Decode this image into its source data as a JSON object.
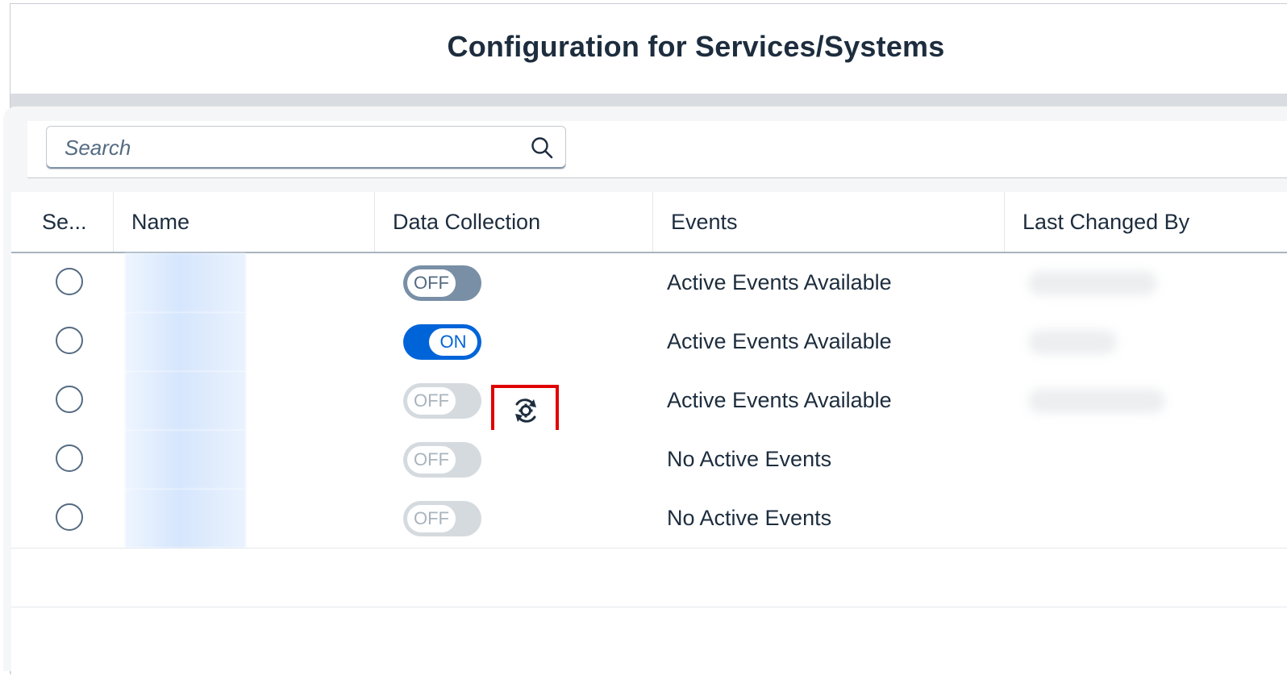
{
  "header": {
    "title": "Configuration for Services/Systems"
  },
  "search": {
    "placeholder": "Search",
    "value": ""
  },
  "table": {
    "columns": [
      {
        "key": "select",
        "label": "Se..."
      },
      {
        "key": "name",
        "label": "Name"
      },
      {
        "key": "data_collection",
        "label": "Data Collection"
      },
      {
        "key": "events",
        "label": "Events"
      },
      {
        "key": "last_changed_by",
        "label": "Last Changed By"
      }
    ],
    "rows": [
      {
        "toggle_state": "off",
        "toggle_label": "OFF",
        "events": "Active Events Available",
        "name": "",
        "last_changed_by": ""
      },
      {
        "toggle_state": "on",
        "toggle_label": "ON",
        "events": "Active Events Available",
        "name": "",
        "last_changed_by": ""
      },
      {
        "toggle_state": "off-disabled",
        "toggle_label": "OFF",
        "events": "Active Events Available",
        "name": "",
        "last_changed_by": "",
        "action_icon": "sync-settings-icon"
      },
      {
        "toggle_state": "off-disabled",
        "toggle_label": "OFF",
        "events": "No Active Events",
        "name": "",
        "last_changed_by": ""
      },
      {
        "toggle_state": "off-disabled",
        "toggle_label": "OFF",
        "events": "No Active Events",
        "name": "",
        "last_changed_by": ""
      }
    ]
  },
  "colors": {
    "accent": "#0064d9",
    "highlight": "#e00000",
    "toggle_off": "#788fa6",
    "toggle_disabled": "#d5dadf"
  }
}
